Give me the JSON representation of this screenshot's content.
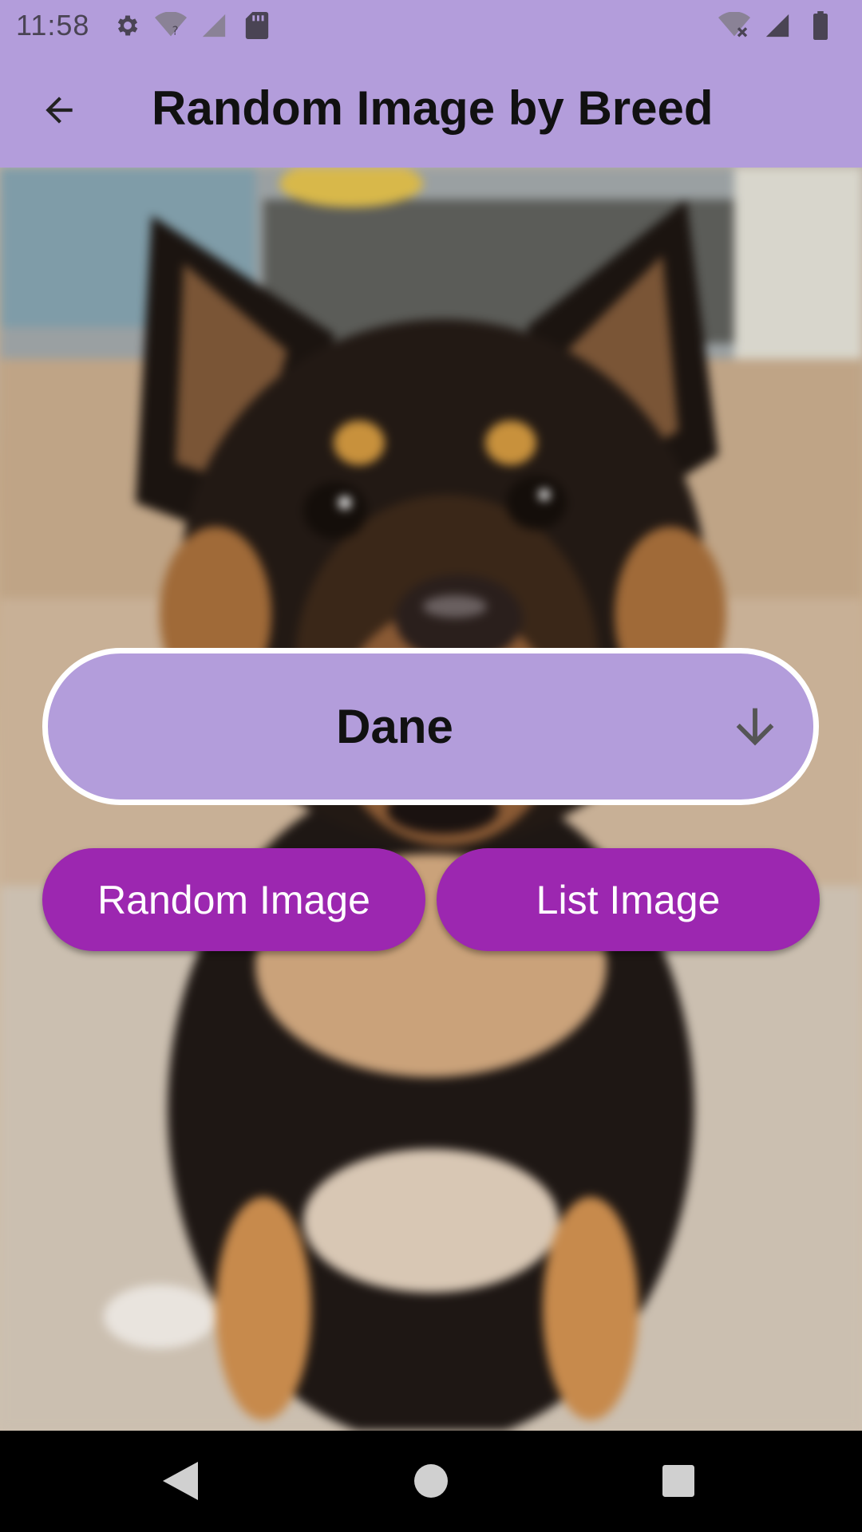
{
  "status_bar": {
    "time": "11:58",
    "icons_left": [
      "settings-icon",
      "wifi-unknown-icon",
      "signal-off-icon",
      "sd-card-icon"
    ],
    "icons_right": [
      "wifi-off-icon",
      "cell-signal-icon",
      "battery-icon"
    ]
  },
  "app_bar": {
    "title": "Random Image by Breed",
    "back_icon": "arrow-back-icon",
    "background": "#b39ddb"
  },
  "photo": {
    "subject_icon": "dog-photo"
  },
  "dropdown": {
    "selected": "Dane",
    "arrow_icon": "arrow-down-icon",
    "background": "#b39ddb",
    "border": "#ffffff"
  },
  "buttons": {
    "random_label": "Random Image",
    "list_label": "List Image",
    "color": "#9c27b0"
  },
  "nav_bar": {
    "back_icon": "nav-back-icon",
    "home_icon": "nav-home-icon",
    "recents_icon": "nav-recents-icon"
  }
}
